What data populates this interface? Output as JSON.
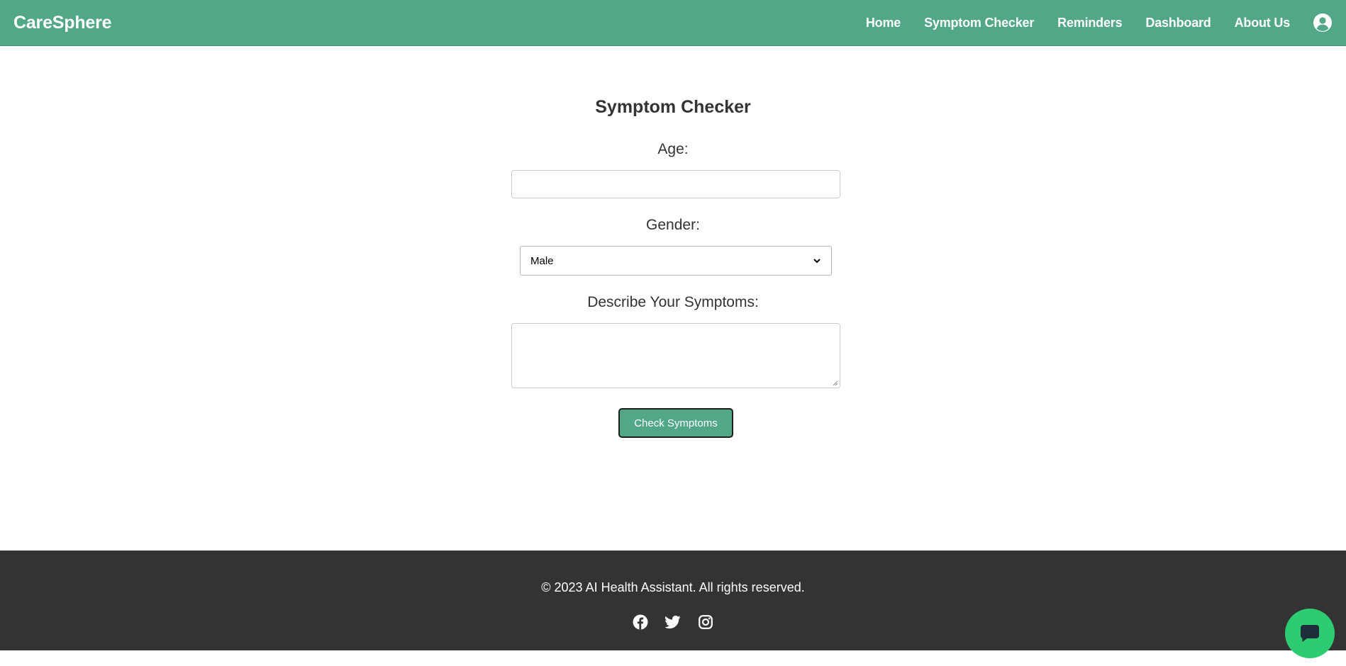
{
  "app": {
    "brand": "CareSphere"
  },
  "nav": {
    "items": [
      {
        "label": "Home"
      },
      {
        "label": "Symptom Checker"
      },
      {
        "label": "Reminders"
      },
      {
        "label": "Dashboard"
      },
      {
        "label": "About Us"
      }
    ],
    "profile_icon": "user-circle-icon"
  },
  "form": {
    "title": "Symptom Checker",
    "age_label": "Age:",
    "age_value": "",
    "gender_label": "Gender:",
    "gender_selected": "Male",
    "symptoms_label": "Describe Your Symptoms:",
    "symptoms_value": "",
    "submit_label": "Check Symptoms"
  },
  "footer": {
    "copyright": "© 2023 AI Health Assistant. All rights reserved.",
    "socials": [
      "facebook-icon",
      "twitter-icon",
      "instagram-icon"
    ]
  },
  "chat": {
    "icon": "chat-bubble-icon"
  },
  "colors": {
    "accent": "#52a886",
    "footer_bg": "#333333",
    "chat_button": "#2ecc71",
    "text": "#333333"
  }
}
